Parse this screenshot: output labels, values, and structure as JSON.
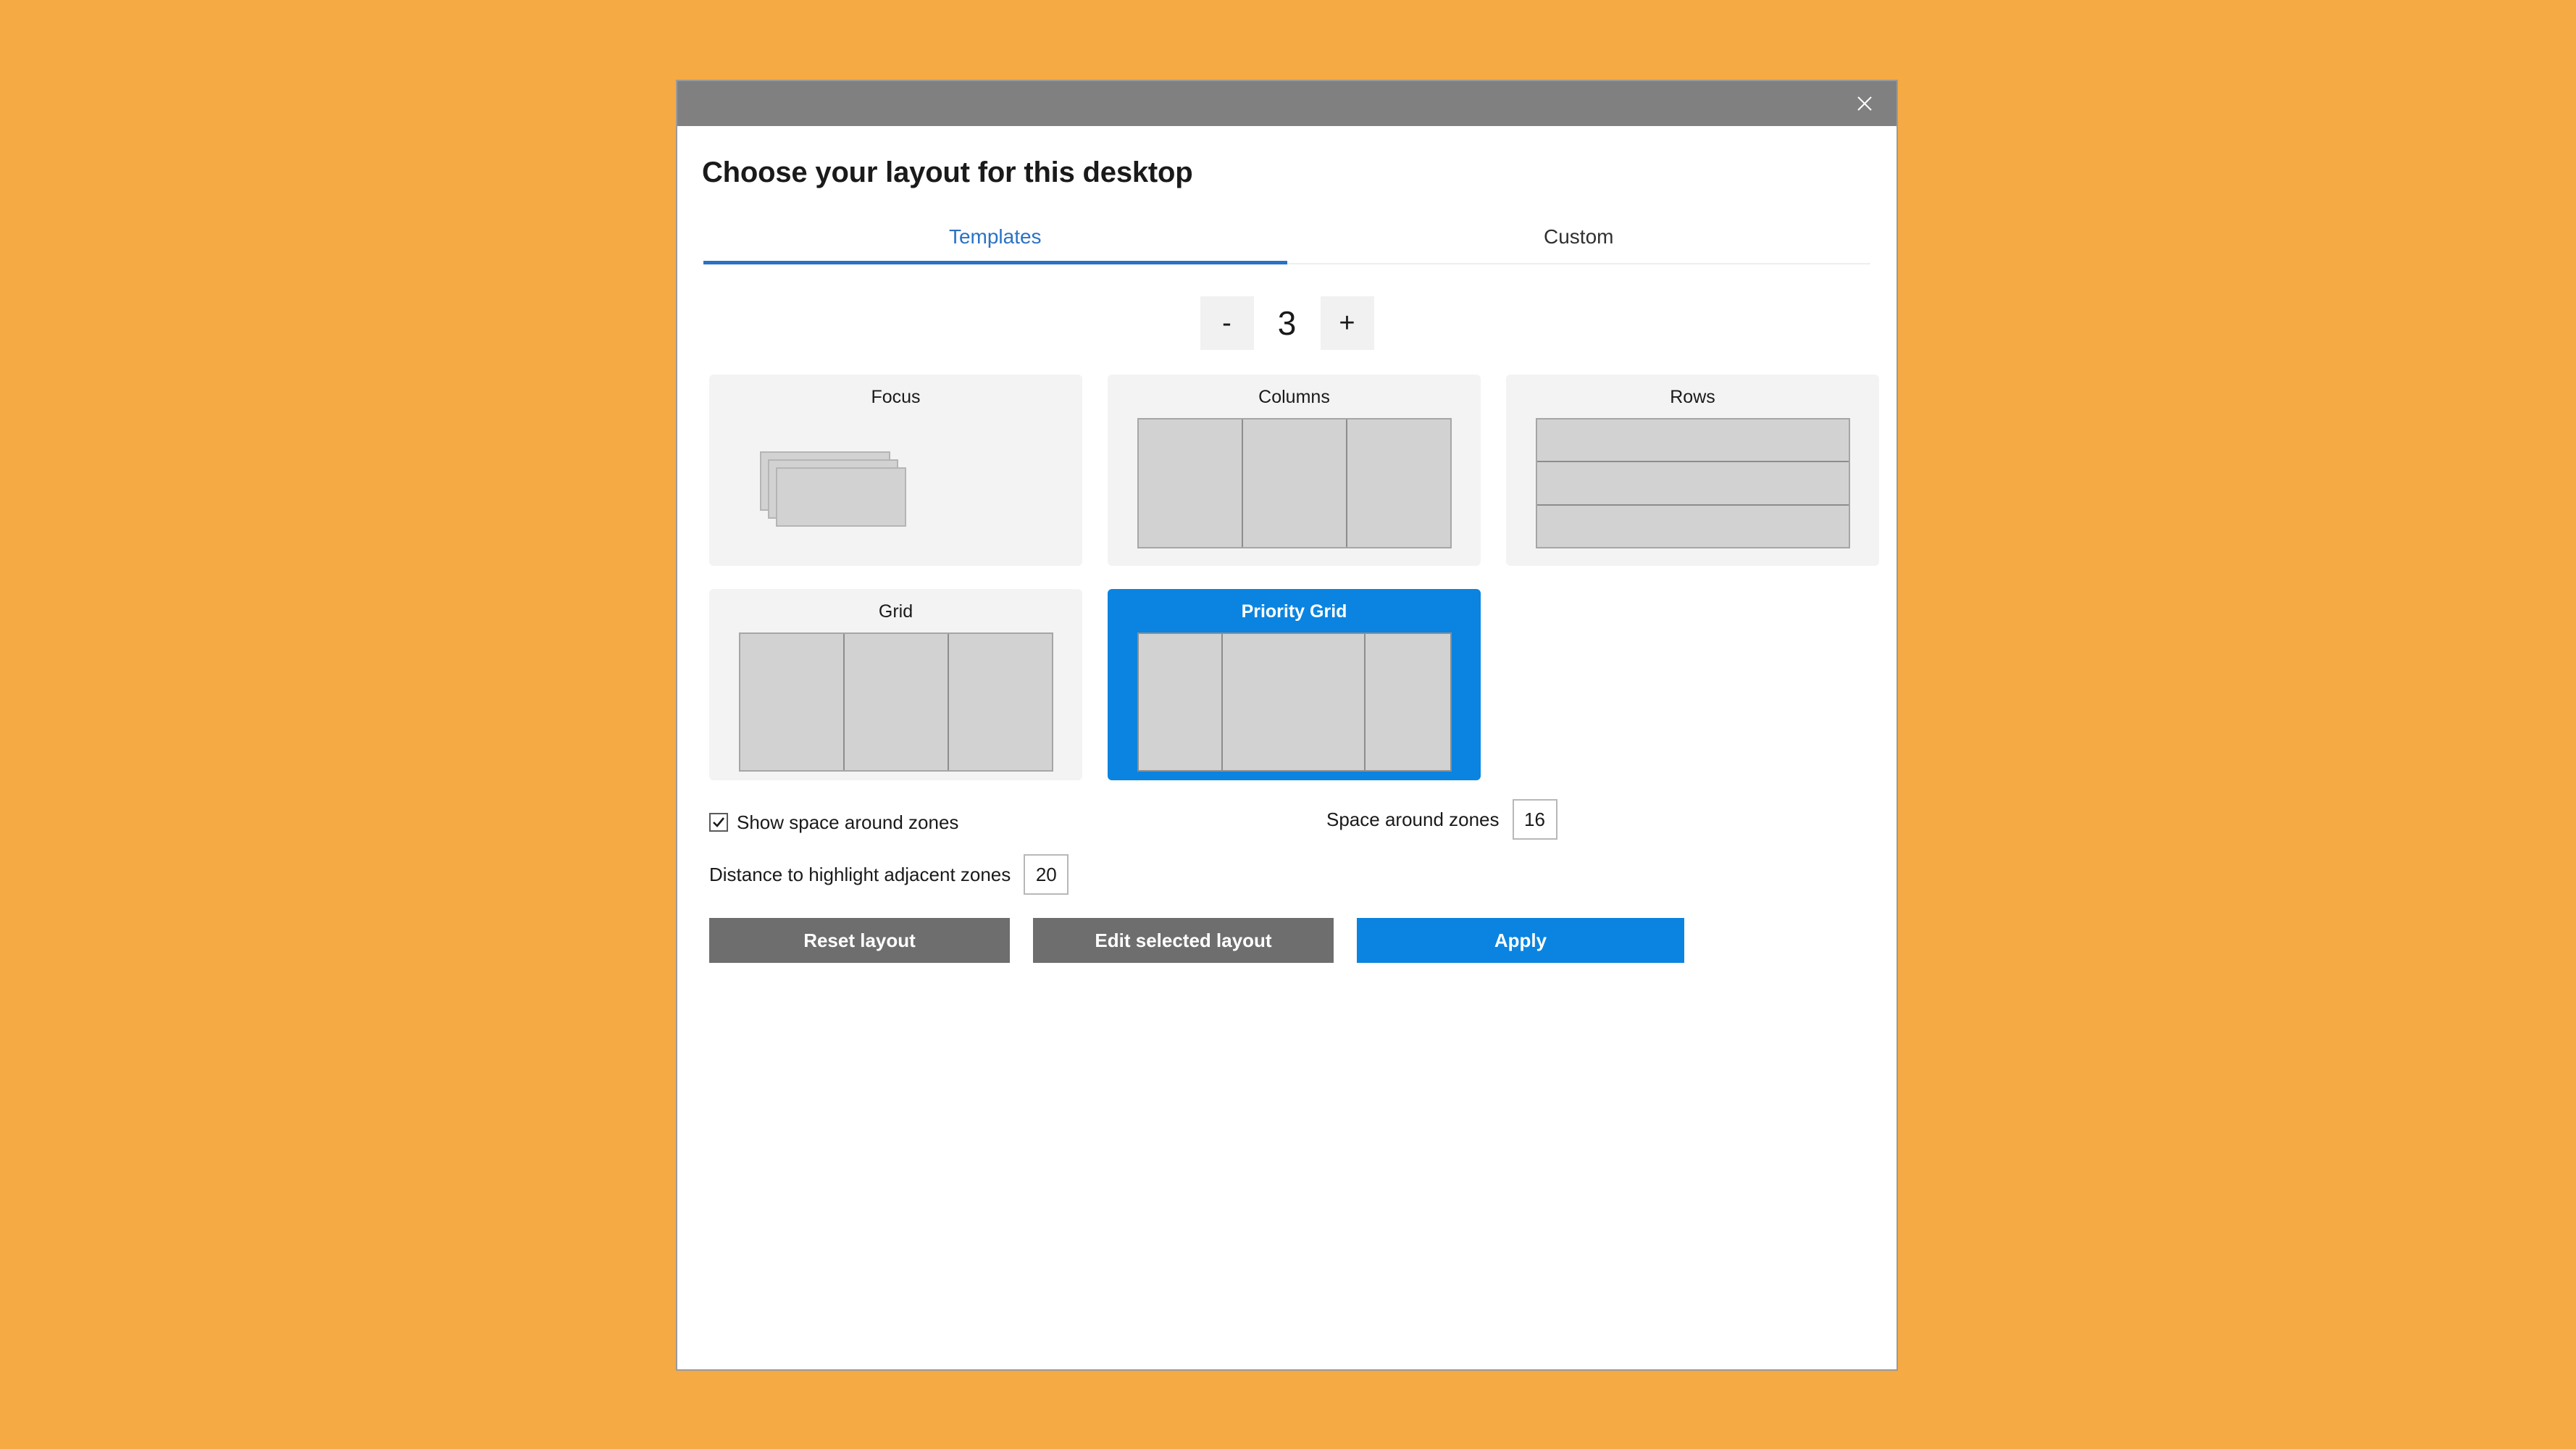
{
  "desktop": {
    "background_color": "#f5aa44"
  },
  "window": {
    "titlebar": {
      "close_icon": "close-icon"
    },
    "title": "Choose your layout for this desktop",
    "tabs": [
      {
        "label": "Templates",
        "active": true
      },
      {
        "label": "Custom",
        "active": false
      }
    ],
    "zone_count": {
      "decrement_label": "-",
      "value": "3",
      "increment_label": "+"
    },
    "templates": [
      {
        "name": "Focus",
        "preview": "focus",
        "selected": false
      },
      {
        "name": "Columns",
        "preview": "columns",
        "selected": false
      },
      {
        "name": "Rows",
        "preview": "rows",
        "selected": false
      },
      {
        "name": "Grid",
        "preview": "grid",
        "selected": false
      },
      {
        "name": "Priority Grid",
        "preview": "priority-grid",
        "selected": true
      }
    ],
    "settings": {
      "show_space_label": "Show space around zones",
      "show_space_checked": true,
      "space_around_label": "Space around zones",
      "space_around_value": "16",
      "distance_label": "Distance to highlight adjacent zones",
      "distance_value": "20"
    },
    "footer": {
      "reset_label": "Reset layout",
      "edit_label": "Edit selected layout",
      "apply_label": "Apply"
    },
    "colors": {
      "accent": "#0a84e0",
      "tab_active": "#2a72c4",
      "titlebar": "#808080",
      "button_gray": "#6e6e6e"
    }
  }
}
